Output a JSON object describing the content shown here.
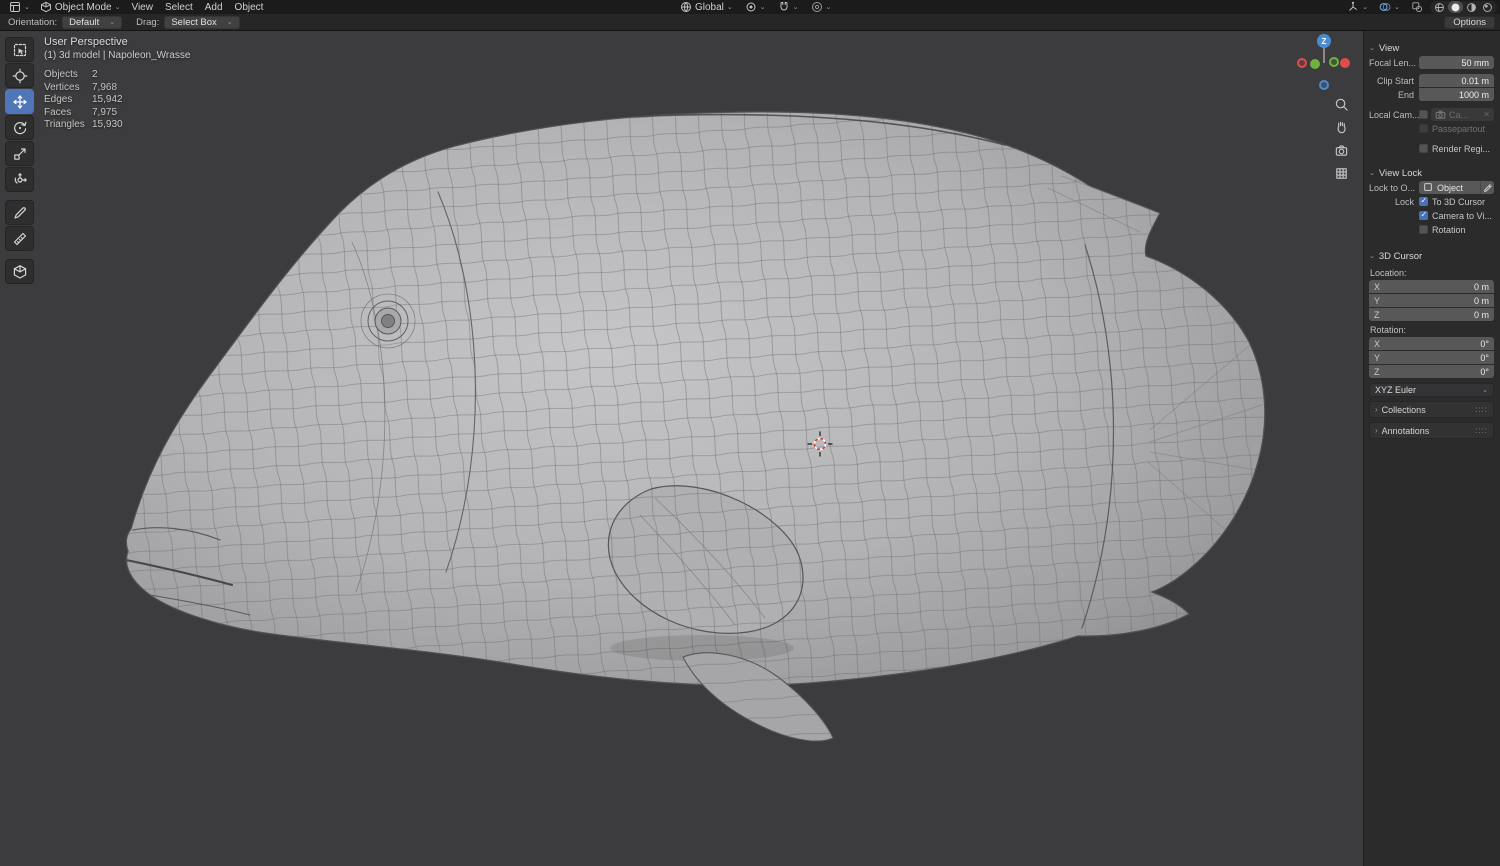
{
  "colors": {
    "accent": "#4f76b8",
    "checkbox-blue": "#4772b3",
    "axis-x": "#e04c4c",
    "axis-y": "#6fb33f",
    "axis-z": "#4a8cd4"
  },
  "topbar": {
    "mode": "Object Mode",
    "menus": [
      "View",
      "Select",
      "Add",
      "Object"
    ],
    "orientation": "Global"
  },
  "tool_settings": {
    "orientation_label": "Orientation:",
    "orientation_value": "Default",
    "drag_label": "Drag:",
    "drag_value": "Select Box",
    "options": "Options"
  },
  "overlay": {
    "view_name": "User Perspective",
    "scene_info": "(1) 3d model | Napoleon_Wrasse",
    "stats": [
      {
        "label": "Objects",
        "value": "2"
      },
      {
        "label": "Vertices",
        "value": "7,968"
      },
      {
        "label": "Edges",
        "value": "15,942"
      },
      {
        "label": "Faces",
        "value": "7,975"
      },
      {
        "label": "Triangles",
        "value": "15,930"
      }
    ]
  },
  "gizmo": {
    "z_label": "Z"
  },
  "sidebar": {
    "view": {
      "title": "View",
      "focal_label": "Focal Len...",
      "focal_value": "50 mm",
      "clip_start_label": "Clip Start",
      "clip_start_value": "0.01 m",
      "clip_end_label": "End",
      "clip_end_value": "1000 m",
      "local_camera_label": "Local Cam...",
      "local_camera_value": "Ca...",
      "passepartout_label": "Passepartout",
      "render_region_label": "Render Regi..."
    },
    "view_lock": {
      "title": "View Lock",
      "lock_to_label": "Lock to O...",
      "lock_to_value": "Object",
      "lock_label": "Lock",
      "to_3d_cursor": "To 3D Cursor",
      "camera_to_view": "Camera to Vi...",
      "rotation": "Rotation"
    },
    "cursor": {
      "title": "3D Cursor",
      "location_label": "Location:",
      "loc": [
        {
          "axis": "X",
          "value": "0 m"
        },
        {
          "axis": "Y",
          "value": "0 m"
        },
        {
          "axis": "Z",
          "value": "0 m"
        }
      ],
      "rotation_label": "Rotation:",
      "rot": [
        {
          "axis": "X",
          "value": "0°"
        },
        {
          "axis": "Y",
          "value": "0°"
        },
        {
          "axis": "Z",
          "value": "0°"
        }
      ],
      "euler": "XYZ Euler"
    },
    "collections_title": "Collections",
    "annotations_title": "Annotations"
  }
}
